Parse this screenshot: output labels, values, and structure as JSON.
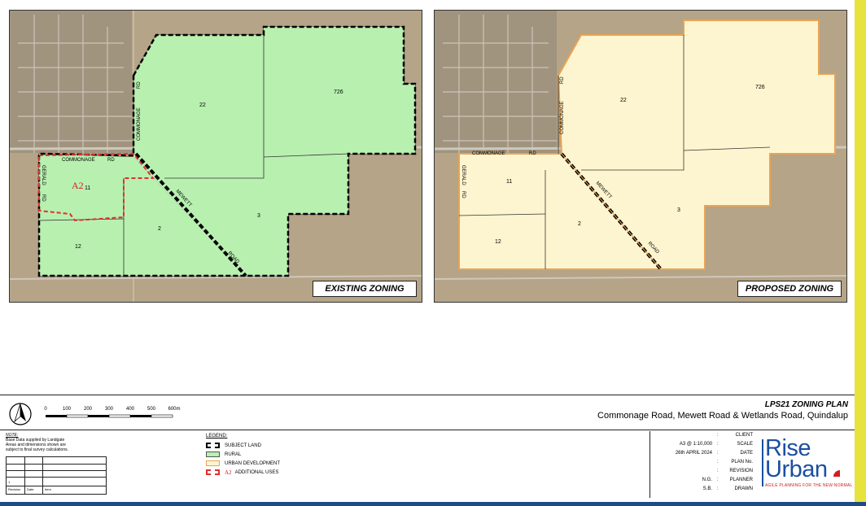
{
  "maps": [
    {
      "caption": "EXISTING ZONING",
      "labels": {
        "lot22": "22",
        "lot726": "726",
        "lot11": "11",
        "lot2": "2",
        "lot3": "3",
        "lot12": "12",
        "a2": "A2",
        "commonage_rd": "COMMONAGE",
        "rd1": "RD",
        "commonage_v": "COMMONAGE",
        "rd_v": "RD",
        "mewett": "MEWETT",
        "road": "ROAD",
        "gerald": "GERALD",
        "rd2": "RD"
      }
    },
    {
      "caption": "PROPOSED ZONING",
      "labels": {
        "lot22": "22",
        "lot726": "726",
        "lot11": "11",
        "lot2": "2",
        "lot3": "3",
        "lot12": "12",
        "commonage_rd": "COMMONAGE",
        "rd1": "RD",
        "commonage_v": "COMMONAGE",
        "rd_v": "RD",
        "mewett": "MEWETT",
        "road": "ROAD",
        "gerald": "GERALD",
        "rd2": "RD"
      }
    }
  ],
  "scale": {
    "ticks": [
      "0",
      "100",
      "200",
      "300",
      "400",
      "500",
      "600m"
    ]
  },
  "plan": {
    "title": "LPS21 ZONING PLAN",
    "subtitle": "Commonage Road, Mewett Road & Wetlands Road, Quindalup"
  },
  "note": {
    "head": "NOTE:",
    "lines": [
      "Base Data supplied by Landgate",
      "Areas and dimensions shown are",
      "subject to final survey calculations."
    ]
  },
  "revision_table": {
    "cols": [
      "Revision",
      "Date",
      "Item"
    ],
    "first": "1"
  },
  "legend": {
    "heading": "LEGEND:",
    "items": [
      "SUBJECT LAND",
      "RURAL",
      "URBAN DEVELOPMENT",
      "ADDITIONAL USES"
    ],
    "a2_prefix": "A2"
  },
  "info": [
    {
      "value": "",
      "key": "CLIENT"
    },
    {
      "value": "A3 @ 1:10,000",
      "key": "SCALE"
    },
    {
      "value": "26th APRIL 2024",
      "key": "DATE"
    },
    {
      "value": "",
      "key": "PLAN No."
    },
    {
      "value": "",
      "key": "REVISION"
    },
    {
      "value": "N.G.",
      "key": "PLANNER"
    },
    {
      "value": "S.B.",
      "key": "DRAWN"
    }
  ],
  "logo": {
    "line1": "Rise",
    "line2": "Urban",
    "tagline": "AGILE PLANNING FOR THE NEW NORMAL"
  },
  "colors": {
    "rural": "#b8f0b0",
    "urban": "#fdf5cf",
    "urban_border": "#e8a455",
    "additional_uses": "#e03030",
    "aerial": "#b9a88e",
    "brand_blue": "#1b4fa0",
    "brand_red": "#d02020"
  }
}
